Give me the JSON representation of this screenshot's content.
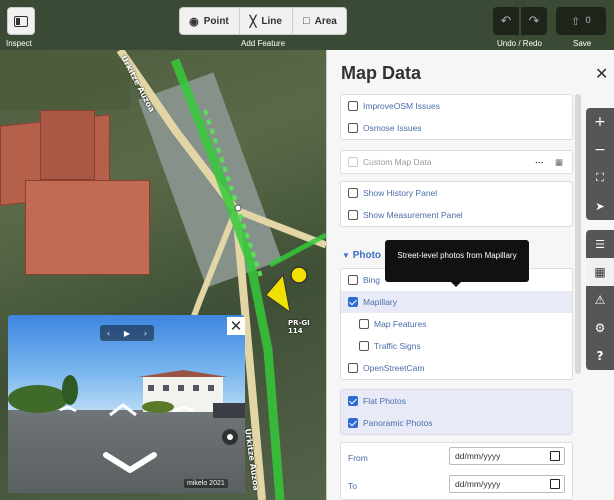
{
  "topbar": {
    "inspect_label": "Inspect",
    "add_feature_label": "Add Feature",
    "point_label": "Point",
    "line_label": "Line",
    "area_label": "Area",
    "undo_redo_label": "Undo / Redo",
    "save_label": "Save",
    "save_count": "0"
  },
  "map": {
    "road_label_1": "Urkitze Auzoa",
    "road_label_2": "Urkitze Auzoa",
    "trail_label": "PR-GI 114"
  },
  "viewer": {
    "credit": "mikelo 2021"
  },
  "panel": {
    "title": "Map Data",
    "section_photo": "Photo",
    "tooltip": "Street-level photos from Mapillary",
    "items": {
      "improveosm": "ImproveOSM Issues",
      "osmose": "Osmose Issues",
      "custom": "Custom Map Data",
      "history": "Show History Panel",
      "measurement": "Show Measurement Panel",
      "bing": "Bing",
      "mapillary": "Mapillary",
      "map_features": "Map Features",
      "traffic_signs": "Traffic Signs",
      "openstreetcam": "OpenStreetCam",
      "flat_photos": "Flat Photos",
      "panoramic_photos": "Panoramic Photos"
    },
    "from_label": "From",
    "to_label": "To",
    "date_placeholder": "dd/mm/yyyy"
  }
}
